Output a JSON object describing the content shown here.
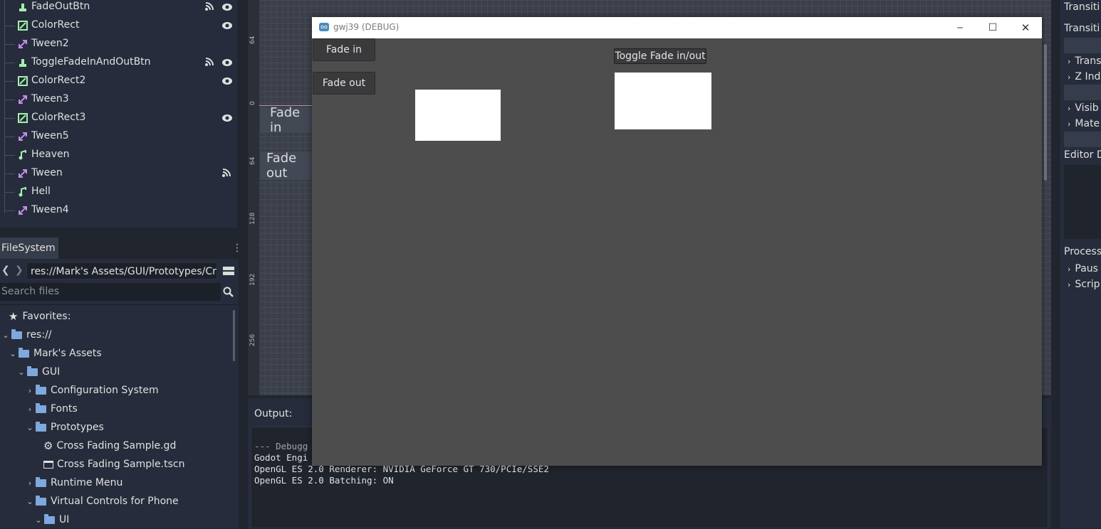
{
  "scene_tree": {
    "items": [
      {
        "label": "FadeOutBtn",
        "icon": "button-node-icon",
        "signal": true,
        "eye": true
      },
      {
        "label": "ColorRect",
        "icon": "colorrect-node-icon",
        "signal": false,
        "eye": true
      },
      {
        "label": "Tween2",
        "icon": "tween-node-icon",
        "signal": false,
        "eye": false
      },
      {
        "label": "ToggleFadeInAndOutBtn",
        "icon": "button-node-icon",
        "signal": true,
        "eye": true
      },
      {
        "label": "ColorRect2",
        "icon": "colorrect-node-icon",
        "signal": false,
        "eye": true
      },
      {
        "label": "Tween3",
        "icon": "tween-node-icon",
        "signal": false,
        "eye": false
      },
      {
        "label": "ColorRect3",
        "icon": "colorrect-node-icon",
        "signal": false,
        "eye": true
      },
      {
        "label": "Tween5",
        "icon": "tween-node-icon",
        "signal": false,
        "eye": false
      },
      {
        "label": "Heaven",
        "icon": "audio-node-icon",
        "signal": false,
        "eye": false
      },
      {
        "label": "Tween",
        "icon": "tween-node-icon",
        "signal": true,
        "eye": false
      },
      {
        "label": "Hell",
        "icon": "audio-node-icon",
        "signal": false,
        "eye": false
      },
      {
        "label": "Tween4",
        "icon": "tween-node-icon",
        "signal": false,
        "eye": false
      }
    ]
  },
  "filesystem": {
    "tab_label": "FileSystem",
    "path": "res://Mark's Assets/GUI/Prototypes/Cr",
    "search_placeholder": "Search files",
    "favorites_label": "Favorites:",
    "tree": [
      {
        "label": "res://",
        "type": "folder",
        "expanded": true
      },
      {
        "label": "Mark's Assets",
        "type": "folder",
        "expanded": true
      },
      {
        "label": "GUI",
        "type": "folder",
        "expanded": true
      },
      {
        "label": "Configuration System",
        "type": "folder",
        "expanded": false
      },
      {
        "label": "Fonts",
        "type": "folder",
        "expanded": false
      },
      {
        "label": "Prototypes",
        "type": "folder",
        "expanded": true
      },
      {
        "label": "Cross Fading Sample.gd",
        "type": "script"
      },
      {
        "label": "Cross Fading Sample.tscn",
        "type": "scene"
      },
      {
        "label": "Runtime Menu",
        "type": "folder",
        "expanded": false
      },
      {
        "label": "Virtual Controls for Phone",
        "type": "folder",
        "expanded": true
      },
      {
        "label": "UI",
        "type": "folder",
        "expanded": true
      }
    ]
  },
  "editor": {
    "ruler_labels": [
      "64",
      "0",
      "64",
      "128",
      "192",
      "256"
    ],
    "bg_fade_in": "Fade in",
    "bg_fade_out": "Fade out"
  },
  "output": {
    "label": "Output:",
    "lines": [
      "--- Debugg",
      "Godot Engi",
      "OpenGL ES 2.0 Renderer: NVIDIA GeForce GT 730/PCIe/SSE2",
      "OpenGL ES 2.0 Batching: ON"
    ]
  },
  "inspector": {
    "labels": [
      "Transiti",
      "Transiti",
      "Trans",
      "Z Ind",
      "Visib",
      "Mate",
      "Editor D",
      "Process",
      "Paus",
      "Scrip"
    ]
  },
  "game_window": {
    "title": "gwj39 (DEBUG)",
    "fade_in_label": "Fade in",
    "fade_out_label": "Fade out",
    "toggle_label": "Toggle Fade in/out",
    "minimize": "─",
    "maximize": "☐",
    "close": "✕"
  },
  "colors": {
    "editor_bg": "#20252e",
    "game_bg": "#4d4d4d",
    "accent_tree": "#a5efac",
    "accent_tween": "#c38ef1",
    "folder": "#7ea8de"
  }
}
